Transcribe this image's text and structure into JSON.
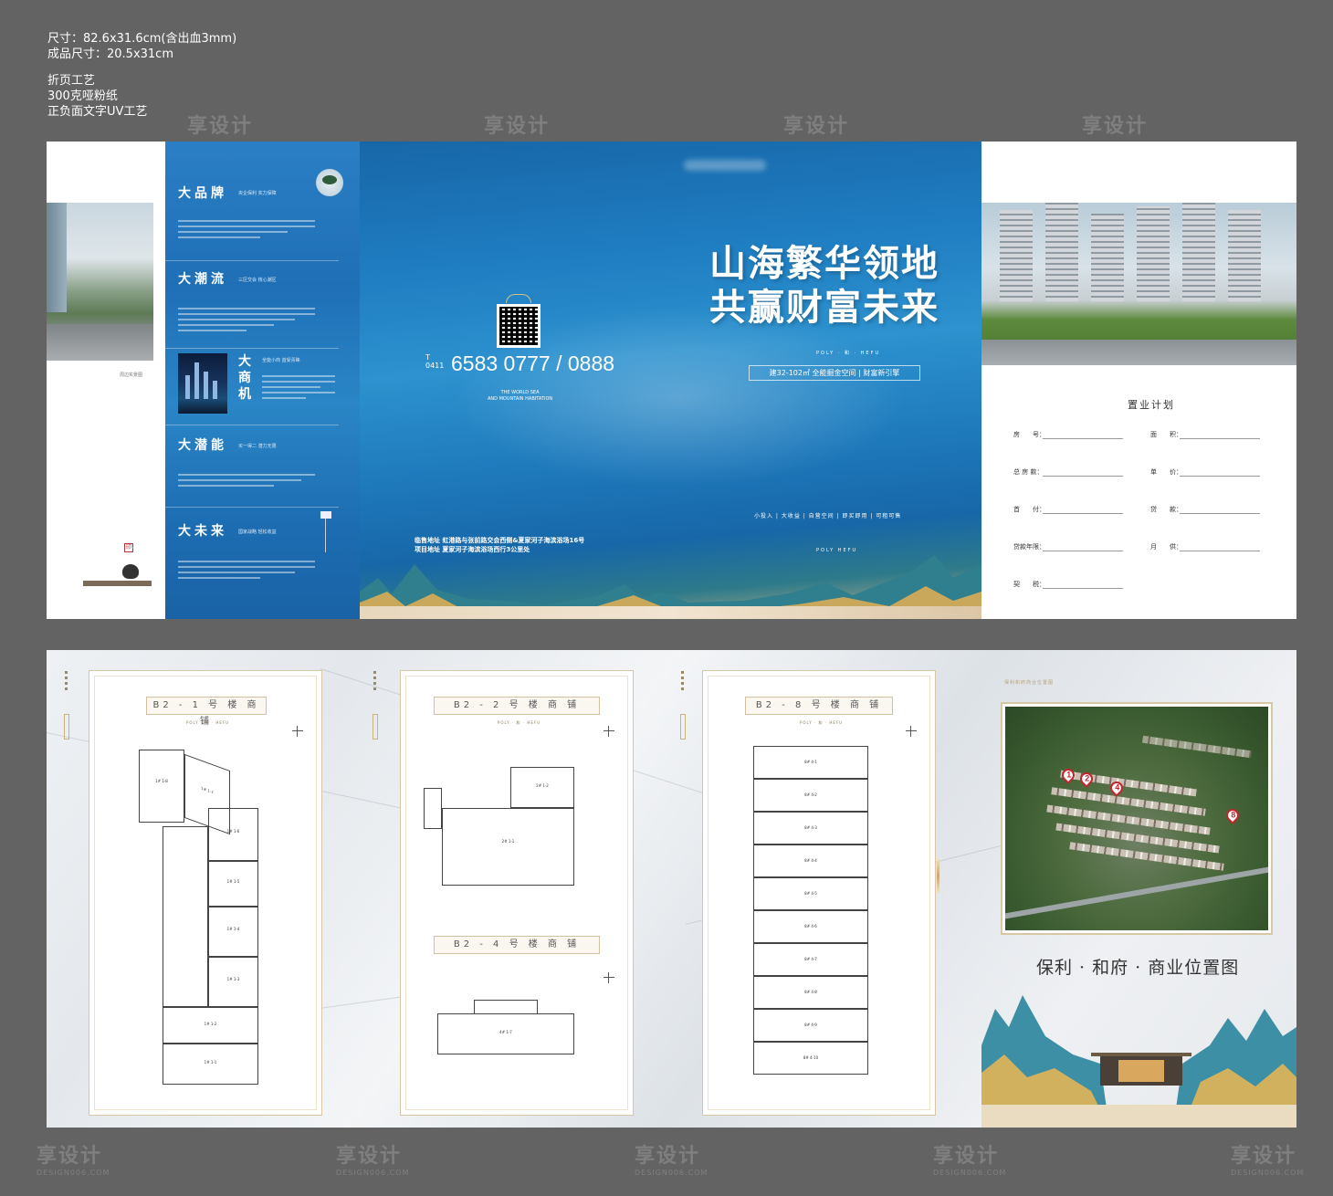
{
  "specs": {
    "size": "尺寸：82.6x31.6cm(含出血3mm)",
    "finished_size": "成品尺寸：20.5x31cm",
    "process": "折页工艺",
    "paper": "300克哑粉纸",
    "finish": "正负面文字UV工艺"
  },
  "watermark": {
    "text": "享设计",
    "sub": "DESIGN006.COM"
  },
  "left_panel": {
    "sections": [
      {
        "title": "大品牌",
        "subtitle": "央企保利 实力保障"
      },
      {
        "title": "大潮流",
        "subtitle": "三区交会 核心潮区"
      },
      {
        "title": "大商机",
        "subtitle": "全能小商 首受青睐"
      },
      {
        "title": "大潜能",
        "subtitle": "买一得二 潜力无限"
      },
      {
        "title": "大未来",
        "subtitle": "国家战略 轻松收益"
      }
    ],
    "photo_caption": "周边实景图"
  },
  "cover": {
    "tel_prefix": "T\n0411",
    "tel": "6583 0777 / 0888",
    "tagline_en": "THE WORLD SEA\nAND MOUNTAIN HABITATION",
    "headline_line1": "山海繁华领地",
    "headline_line2": "共赢财富未来",
    "brand": "POLY · 和 · HEFU",
    "area": "建32-102㎡ 全能掘金空间 | 财富新引擎",
    "features": "小投入 | 大收益 | 自营空间 | 即买即用 | 可租可售",
    "small_logo": "POLY HEFU",
    "address_line1": "临售地址  虹港路与张前路交会西侧&夏家河子海滨浴场16号",
    "address_line2": "项目地址  夏家河子海滨浴场西行3公里处"
  },
  "purchase_plan": {
    "title": "置业计划",
    "fields": [
      {
        "label": "房　　号："
      },
      {
        "label": "面　　积："
      },
      {
        "label": "总 房 款："
      },
      {
        "label": "单　　价："
      },
      {
        "label": "首　　付："
      },
      {
        "label": "贷　　款："
      },
      {
        "label": "贷款年限："
      },
      {
        "label": "月　　供："
      },
      {
        "label": "契　　税："
      }
    ]
  },
  "floor_plans": [
    {
      "title": "B2 - 1 号 楼 商 铺",
      "units": [
        "1# 1-8",
        "1# 1-7",
        "1# 1-6",
        "1# 1-5",
        "1# 1-4",
        "1# 1-3",
        "1# 1-2",
        "1# 1-1"
      ]
    },
    {
      "title": "B2 - 2 号 楼 商 铺",
      "units": [
        "2# 1-2",
        "2# 1-1"
      ]
    },
    {
      "title": "B2 - 4 号 楼 商 铺",
      "units": [
        "4# 1-7"
      ]
    },
    {
      "title": "B2 - 8 号 楼 商 铺",
      "units": [
        "8# 4-1",
        "8# 4-2",
        "8# 4-3",
        "8# 4-4",
        "8# 4-5",
        "8# 4-6",
        "8# 4-7",
        "8# 4-8",
        "8# 4-9",
        "8# 4-10"
      ]
    }
  ],
  "sheet_logo": "POLY · 和 · HEFU",
  "location": {
    "label_top": "保利和府商业位置图",
    "title": "保利 · 和府 · 商业位置图",
    "pins": [
      "1",
      "2",
      "4",
      "8"
    ]
  },
  "colors": {
    "background": "#636363",
    "cover_blue": "#1f7dc1",
    "gold": "#d8c7a3",
    "pin_red": "#c0262c"
  }
}
